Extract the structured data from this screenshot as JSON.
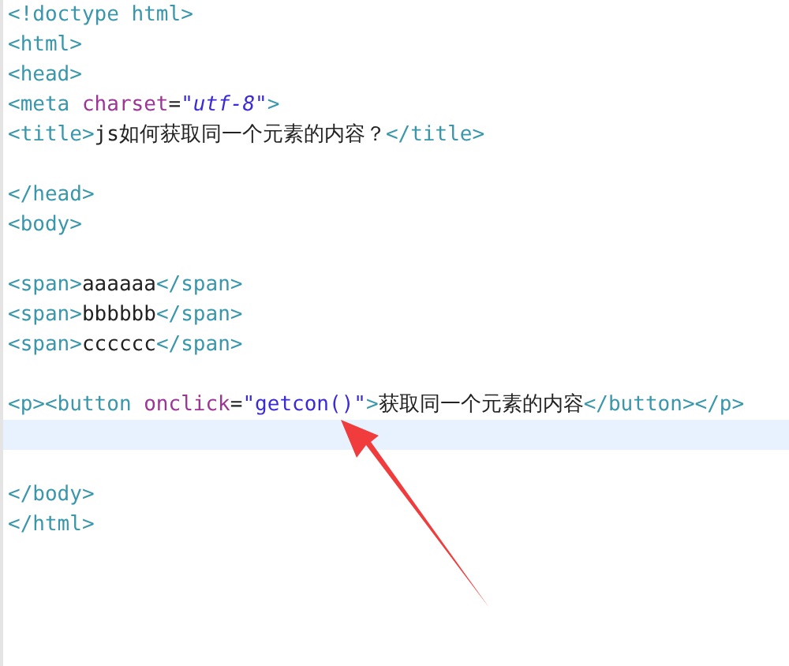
{
  "editor": {
    "lines": [
      {
        "current": false,
        "tokens": [
          {
            "kind": "tag",
            "text": "<!doctype html>"
          }
        ]
      },
      {
        "current": false,
        "tokens": [
          {
            "kind": "tag",
            "text": "<html>"
          }
        ]
      },
      {
        "current": false,
        "tokens": [
          {
            "kind": "tag",
            "text": "<head>"
          }
        ]
      },
      {
        "current": false,
        "tokens": [
          {
            "kind": "tag",
            "text": "<meta "
          },
          {
            "kind": "attr",
            "text": "charset"
          },
          {
            "kind": "punct",
            "text": "="
          },
          {
            "kind": "string",
            "italic": true,
            "text": "\"utf-8\""
          },
          {
            "kind": "tag",
            "text": ">"
          }
        ]
      },
      {
        "current": false,
        "tokens": [
          {
            "kind": "tag",
            "text": "<title>"
          },
          {
            "kind": "text",
            "text": "js如何获取同一个元素的内容？"
          },
          {
            "kind": "tag",
            "text": "</title>"
          }
        ]
      },
      {
        "current": false
      },
      {
        "current": false,
        "tokens": [
          {
            "kind": "tag",
            "text": "</head>"
          }
        ]
      },
      {
        "current": false,
        "tokens": [
          {
            "kind": "tag",
            "text": "<body>"
          }
        ]
      },
      {
        "current": false
      },
      {
        "current": false,
        "tokens": [
          {
            "kind": "tag",
            "text": "<span>"
          },
          {
            "kind": "text",
            "text": "aaaaaa"
          },
          {
            "kind": "tag",
            "text": "</span>"
          }
        ]
      },
      {
        "current": false,
        "tokens": [
          {
            "kind": "tag",
            "text": "<span>"
          },
          {
            "kind": "text",
            "text": "bbbbbb"
          },
          {
            "kind": "tag",
            "text": "</span>"
          }
        ]
      },
      {
        "current": false,
        "tokens": [
          {
            "kind": "tag",
            "text": "<span>"
          },
          {
            "kind": "text",
            "text": "cccccc"
          },
          {
            "kind": "tag",
            "text": "</span>"
          }
        ]
      },
      {
        "current": false
      },
      {
        "current": false,
        "tokens": [
          {
            "kind": "tag",
            "text": "<p><button "
          },
          {
            "kind": "attr",
            "text": "onclick"
          },
          {
            "kind": "punct",
            "text": "="
          },
          {
            "kind": "string",
            "italic": false,
            "text": "\"getcon()\""
          },
          {
            "kind": "tag",
            "text": ">"
          },
          {
            "kind": "text",
            "text": "获取同一个元素的内容"
          },
          {
            "kind": "tag",
            "text": "</button></p>"
          }
        ]
      },
      {
        "current": true
      },
      {
        "current": false
      },
      {
        "current": false,
        "tokens": [
          {
            "kind": "tag",
            "text": "</body>"
          }
        ]
      },
      {
        "current": false,
        "tokens": [
          {
            "kind": "tag",
            "text": "</html>"
          }
        ]
      }
    ]
  }
}
